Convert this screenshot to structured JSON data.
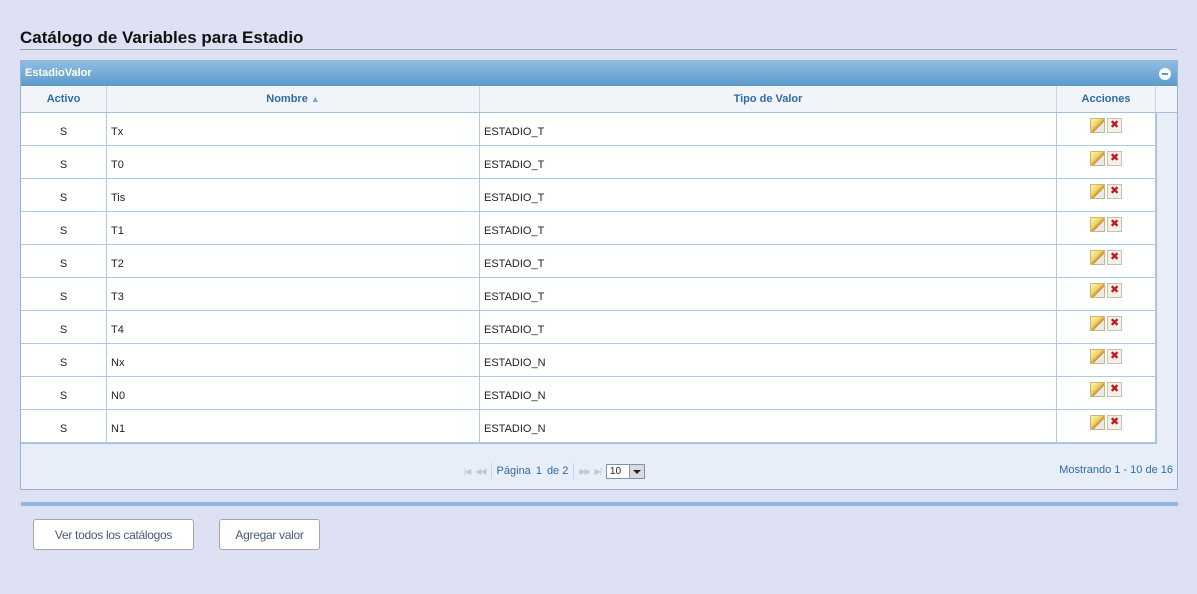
{
  "page": {
    "title": "Catálogo de Variables para Estadio"
  },
  "grid": {
    "caption": "EstadioValor",
    "columns": {
      "activo": "Activo",
      "nombre": "Nombre",
      "tipo": "Tipo de Valor",
      "acciones": "Acciones"
    },
    "rows": [
      {
        "activo": "S",
        "nombre": "Tx",
        "tipo": "ESTADIO_T"
      },
      {
        "activo": "S",
        "nombre": "T0",
        "tipo": "ESTADIO_T"
      },
      {
        "activo": "S",
        "nombre": "Tis",
        "tipo": "ESTADIO_T"
      },
      {
        "activo": "S",
        "nombre": "T1",
        "tipo": "ESTADIO_T"
      },
      {
        "activo": "S",
        "nombre": "T2",
        "tipo": "ESTADIO_T"
      },
      {
        "activo": "S",
        "nombre": "T3",
        "tipo": "ESTADIO_T"
      },
      {
        "activo": "S",
        "nombre": "T4",
        "tipo": "ESTADIO_T"
      },
      {
        "activo": "S",
        "nombre": "Nx",
        "tipo": "ESTADIO_N"
      },
      {
        "activo": "S",
        "nombre": "N0",
        "tipo": "ESTADIO_N"
      },
      {
        "activo": "S",
        "nombre": "N1",
        "tipo": "ESTADIO_N"
      }
    ],
    "pager": {
      "page_label": "Página",
      "page_number": "1",
      "of_label": "de 2",
      "page_size": "10",
      "records_text": "Mostrando 1 - 10 de 16"
    }
  },
  "buttons": {
    "view_all": "Ver todos los catálogos",
    "add_value": "Agregar valor"
  }
}
